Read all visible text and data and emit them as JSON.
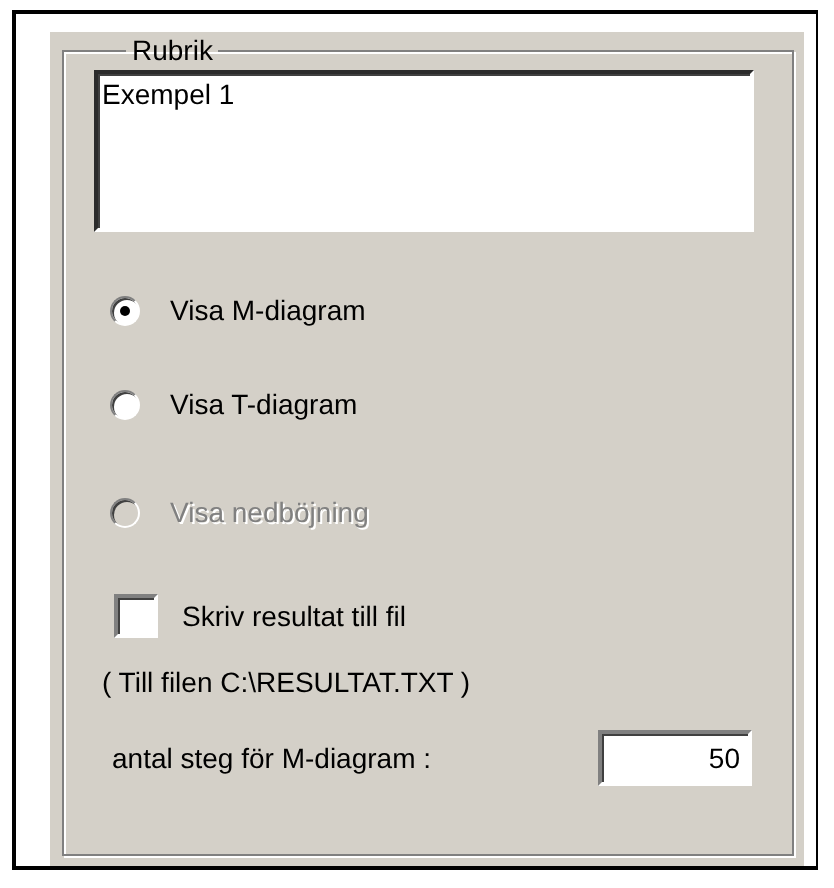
{
  "group": {
    "legend": "Rubrik"
  },
  "title_field": {
    "value": "Exempel 1"
  },
  "radios": [
    {
      "label": "Visa M-diagram",
      "selected": true,
      "disabled": false
    },
    {
      "label": "Visa T-diagram",
      "selected": false,
      "disabled": false
    },
    {
      "label": "Visa nedböjning",
      "selected": false,
      "disabled": true
    }
  ],
  "checkbox": {
    "label": "Skriv resultat till fil",
    "checked": false
  },
  "note": "( Till filen C:\\RESULTAT.TXT )",
  "steps": {
    "label": "antal steg för M-diagram :",
    "value": "50"
  }
}
